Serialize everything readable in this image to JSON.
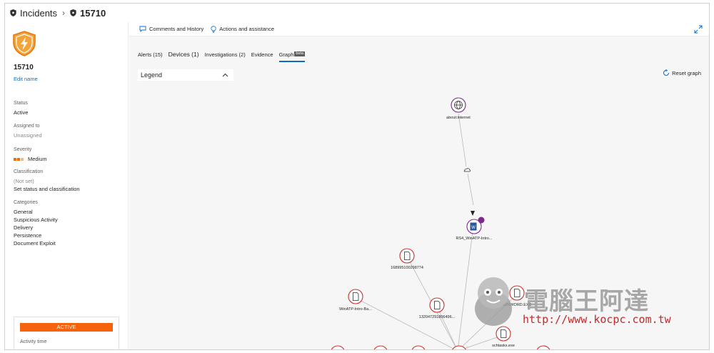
{
  "breadcrumb": {
    "incidents": "Incidents",
    "incident_id": "15710"
  },
  "left_panel": {
    "incident_id": "15710",
    "edit_name": "Edit name",
    "status_label": "Status",
    "status_value": "Active",
    "assigned_label": "Assigned to",
    "assigned_value": "Unassigned",
    "severity_label": "Severity",
    "severity_value": "Medium",
    "classification_label": "Classification",
    "classification_value": "(Not set)",
    "set_status_link": "Set status and classification",
    "categories_label": "Categories",
    "categories": [
      "General",
      "Suspicious Activity",
      "Delivery",
      "Persistence",
      "Document Exploit"
    ],
    "status_card": {
      "pill": "ACTIVE",
      "activity_label": "Activity time"
    }
  },
  "toolbar": {
    "comments": "Comments and History",
    "actions": "Actions and assistance"
  },
  "tabs": [
    {
      "label": "Alerts (15)"
    },
    {
      "label": "Devices (1)"
    },
    {
      "label": "Investigations (2)"
    },
    {
      "label": "Evidence"
    },
    {
      "label": "Graph",
      "badge": "beta"
    }
  ],
  "legend": {
    "label": "Legend"
  },
  "reset_graph": "Reset graph",
  "graph": {
    "nodes": {
      "about_internet": "about:internet",
      "doc": "RS4_WinATP-Intro...",
      "file_a": "1689951002987​74",
      "file_b": "WinATP-Intro-Ba...",
      "file_c": "132047291806496...",
      "file_d": "WINWORD.EXE",
      "file_e": "schtasks.exe"
    }
  },
  "watermark": {
    "title": "電腦王阿達",
    "url": "http://www.kocpc.com.tw"
  },
  "colors": {
    "accent": "#0f6cbd",
    "severity_medium": "#e8730c",
    "active_pill": "#f7630c",
    "node_ring": "#c8332f",
    "node_ring_purple": "#7b2a8c"
  }
}
